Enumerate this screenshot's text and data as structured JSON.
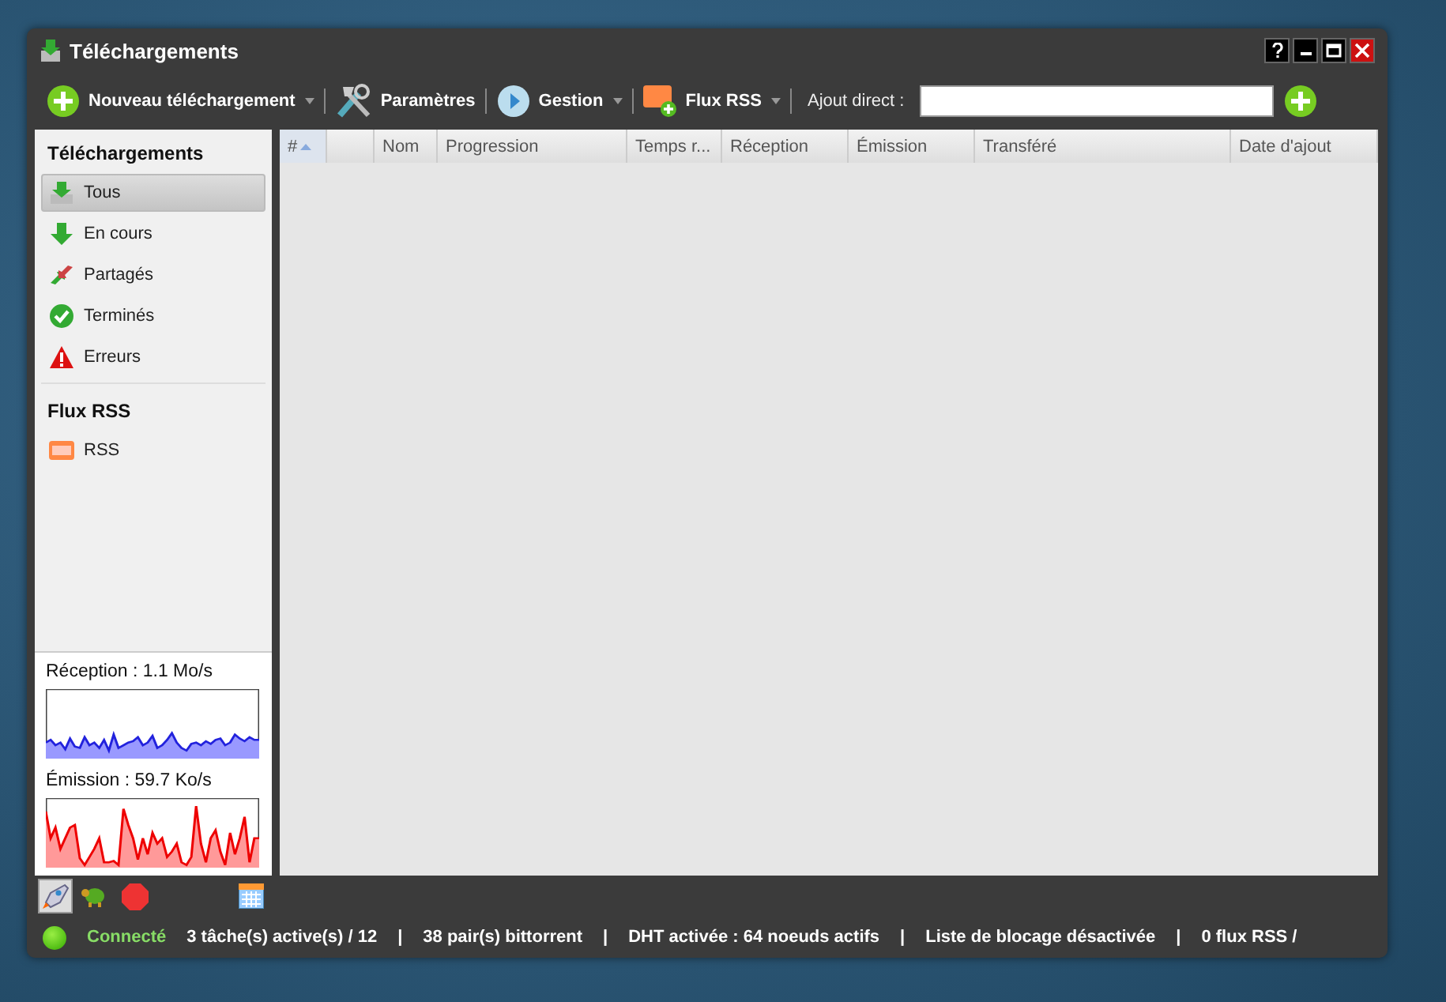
{
  "window": {
    "title": "Téléchargements"
  },
  "toolbar": {
    "buttons": [
      {
        "kind": "add",
        "label": "Nouveau téléchargement",
        "dropdown": true
      },
      {
        "kind": "tools",
        "label": "Paramètres",
        "dropdown": false
      },
      {
        "kind": "play",
        "label": "Gestion",
        "dropdown": true
      },
      {
        "kind": "rss",
        "label": "Flux RSS",
        "dropdown": true
      }
    ],
    "direct_add": {
      "label": "Ajout direct :"
    }
  },
  "sidebar": {
    "sections": [
      {
        "title": "Téléchargements",
        "items": [
          {
            "kind": "all",
            "label": "Tous",
            "selected": true
          },
          {
            "kind": "down",
            "label": "En cours",
            "selected": false
          },
          {
            "kind": "shared",
            "label": "Partagés",
            "selected": false
          },
          {
            "kind": "done",
            "label": "Terminés",
            "selected": false
          },
          {
            "kind": "error",
            "label": "Erreurs",
            "selected": false
          }
        ]
      },
      {
        "title": "Flux RSS",
        "items": [
          {
            "kind": "rss",
            "label": "RSS",
            "selected": false
          }
        ]
      }
    ],
    "graphs": [
      {
        "kind": "down",
        "label": "Réception : 1.1 Mo/s"
      },
      {
        "kind": "up",
        "label": "Émission : 59.7 Ko/s"
      }
    ],
    "tools": [
      {
        "kind": "rocket",
        "selected": true
      },
      {
        "kind": "turtle",
        "selected": false
      },
      {
        "kind": "stop",
        "selected": false
      },
      {
        "kind": "calendar",
        "selected": false
      }
    ]
  },
  "table": {
    "columns": [
      {
        "label": "#",
        "sorted": true
      },
      {
        "sorted": false
      },
      {
        "label": "Nom",
        "sorted": false
      },
      {
        "label": "Progression",
        "sorted": false
      },
      {
        "label": "Temps r...",
        "sorted": false
      },
      {
        "label": "Réception",
        "sorted": false
      },
      {
        "label": "Émission",
        "sorted": false
      },
      {
        "label": "Transféré",
        "sorted": false
      },
      {
        "label": "Date d'ajout",
        "sorted": false
      }
    ]
  },
  "status_bar": {
    "connected": true,
    "segments": [
      {
        "kind": "status",
        "text": "Connecté"
      },
      {
        "kind": "text",
        "text": "3 tâche(s) active(s) / 12"
      },
      {
        "kind": "separator",
        "text": "|"
      },
      {
        "kind": "text",
        "text": "38 pair(s) bittorrent"
      },
      {
        "kind": "separator",
        "text": "|"
      },
      {
        "kind": "text",
        "text": "DHT activée : 64 noeuds actifs"
      },
      {
        "kind": "separator",
        "text": "|"
      },
      {
        "kind": "text",
        "text": "Liste de blocage désactivée"
      },
      {
        "kind": "separator",
        "text": "|"
      },
      {
        "kind": "text",
        "text": "0 flux RSS /"
      }
    ]
  }
}
